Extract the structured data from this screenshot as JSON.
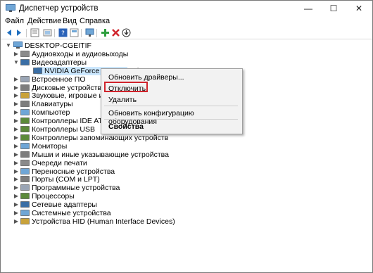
{
  "window": {
    "title": "Диспетчер устройств",
    "controls": {
      "minimize": "—",
      "maximize": "☐",
      "close": "✕"
    }
  },
  "menu": [
    "Файл",
    "Действие",
    "Вид",
    "Справка"
  ],
  "toolbar": {
    "icons": [
      "back-icon",
      "forward-icon",
      "properties-icon",
      "scan-icon",
      "help-icon",
      "show-icon",
      "monitor-icon",
      "add-driver-icon",
      "remove-icon",
      "download-icon"
    ]
  },
  "tree": {
    "root": "DESKTOP-CGEITIF",
    "nodes": [
      {
        "label": "Аудиовходы и аудиовыходы",
        "icon": "audio-icon",
        "state": "collapsed"
      },
      {
        "label": "Видеоадаптеры",
        "icon": "display-adapter-icon",
        "state": "expanded"
      },
      {
        "label": "NVIDIA GeForce GTX 660 Ti",
        "icon": "gpu-icon",
        "state": "child-selected"
      },
      {
        "label": "Встроенное ПО",
        "icon": "firmware-icon",
        "state": "collapsed"
      },
      {
        "label": "Дисковые устройства",
        "icon": "disk-icon",
        "state": "collapsed"
      },
      {
        "label": "Звуковые, игровые и видеоустройства",
        "icon": "sound-icon",
        "state": "collapsed"
      },
      {
        "label": "Клавиатуры",
        "icon": "keyboard-icon",
        "state": "collapsed"
      },
      {
        "label": "Компьютер",
        "icon": "computer-icon",
        "state": "collapsed"
      },
      {
        "label": "Контроллеры IDE ATA/ATAPI",
        "icon": "controller-icon",
        "state": "collapsed"
      },
      {
        "label": "Контроллеры USB",
        "icon": "usb-icon",
        "state": "collapsed"
      },
      {
        "label": "Контроллеры запоминающих устройств",
        "icon": "storage-icon",
        "state": "collapsed"
      },
      {
        "label": "Мониторы",
        "icon": "monitor-icon",
        "state": "collapsed"
      },
      {
        "label": "Мыши и иные указывающие устройства",
        "icon": "mouse-icon",
        "state": "collapsed"
      },
      {
        "label": "Очереди печати",
        "icon": "printer-icon",
        "state": "collapsed"
      },
      {
        "label": "Переносные устройства",
        "icon": "portable-icon",
        "state": "collapsed"
      },
      {
        "label": "Порты (COM и LPT)",
        "icon": "port-icon",
        "state": "collapsed"
      },
      {
        "label": "Программные устройства",
        "icon": "software-icon",
        "state": "collapsed"
      },
      {
        "label": "Процессоры",
        "icon": "cpu-icon",
        "state": "collapsed"
      },
      {
        "label": "Сетевые адаптеры",
        "icon": "network-icon",
        "state": "collapsed"
      },
      {
        "label": "Системные устройства",
        "icon": "system-icon",
        "state": "collapsed"
      },
      {
        "label": "Устройства HID (Human Interface Devices)",
        "icon": "hid-icon",
        "state": "collapsed"
      }
    ]
  },
  "context_menu": {
    "items": [
      {
        "label": "Обновить драйверы..."
      },
      {
        "label": "Отключить",
        "highlighted": true
      },
      {
        "label": "Удалить"
      },
      {
        "label": "Обновить конфигурацию оборудования"
      },
      {
        "label": "Свойства",
        "bold": true
      }
    ],
    "highlight_color": "#d0242c"
  },
  "colors": {
    "selection": "#cce8ff",
    "menu_bg": "#f2f2f2",
    "accent_blue": "#1f6fbf"
  }
}
